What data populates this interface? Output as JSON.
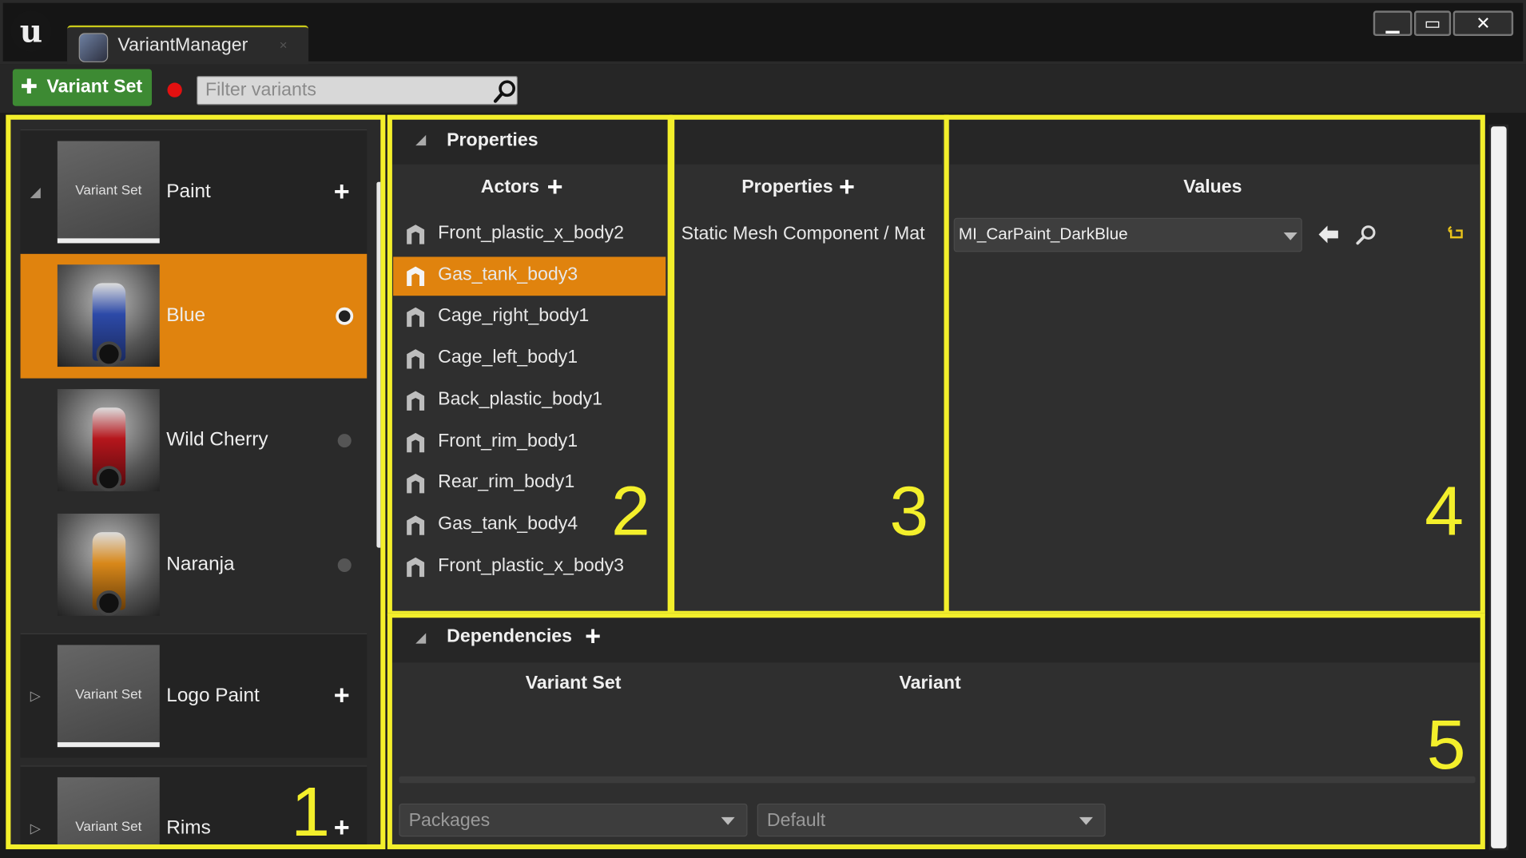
{
  "window": {
    "app_glyph": "u",
    "tab_title": "VariantManager",
    "tab_close": "×",
    "controls": {
      "minimize": "▁",
      "maximize": "▭",
      "close": "✕"
    }
  },
  "toolbar": {
    "add_variant_set_label": "Variant Set",
    "plus_glyph": "✚",
    "filter_placeholder": "Filter variants"
  },
  "variant_sets": [
    {
      "thumb_label": "Variant Set",
      "name": "Paint",
      "expanded": true,
      "variants": [
        {
          "name": "Blue",
          "selected": true,
          "color": "#2d4aa8"
        },
        {
          "name": "Wild Cherry",
          "selected": false,
          "color": "#b5161c"
        },
        {
          "name": "Naranja",
          "selected": false,
          "color": "#d8881a"
        }
      ]
    },
    {
      "thumb_label": "Variant Set",
      "name": "Logo Paint",
      "expanded": false
    },
    {
      "thumb_label": "Variant Set",
      "name": "Rims",
      "expanded": false
    }
  ],
  "properties_panel": {
    "header": "Properties",
    "actors_header": "Actors",
    "actors": [
      "Front_plastic_x_body2",
      "Gas_tank_body3",
      "Cage_right_body1",
      "Cage_left_body1",
      "Back_plastic_body1",
      "Front_rim_body1",
      "Rear_rim_body1",
      "Gas_tank_body4",
      "Front_plastic_x_body3"
    ],
    "selected_actor_index": 1,
    "properties_header": "Properties",
    "property_item": "Static Mesh Component / Mat",
    "values_header": "Values",
    "value_selected": "MI_CarPaint_DarkBlue"
  },
  "dependencies": {
    "header": "Dependencies",
    "col_variant_set": "Variant Set",
    "col_variant": "Variant",
    "packages_combo": "Packages",
    "default_combo": "Default"
  },
  "callouts": [
    "1",
    "2",
    "3",
    "4",
    "5"
  ],
  "colors": {
    "accent_orange": "#e0830e",
    "callout_yellow": "#f3ef2b",
    "add_green": "#3d8a33",
    "record_red": "#e31010"
  }
}
